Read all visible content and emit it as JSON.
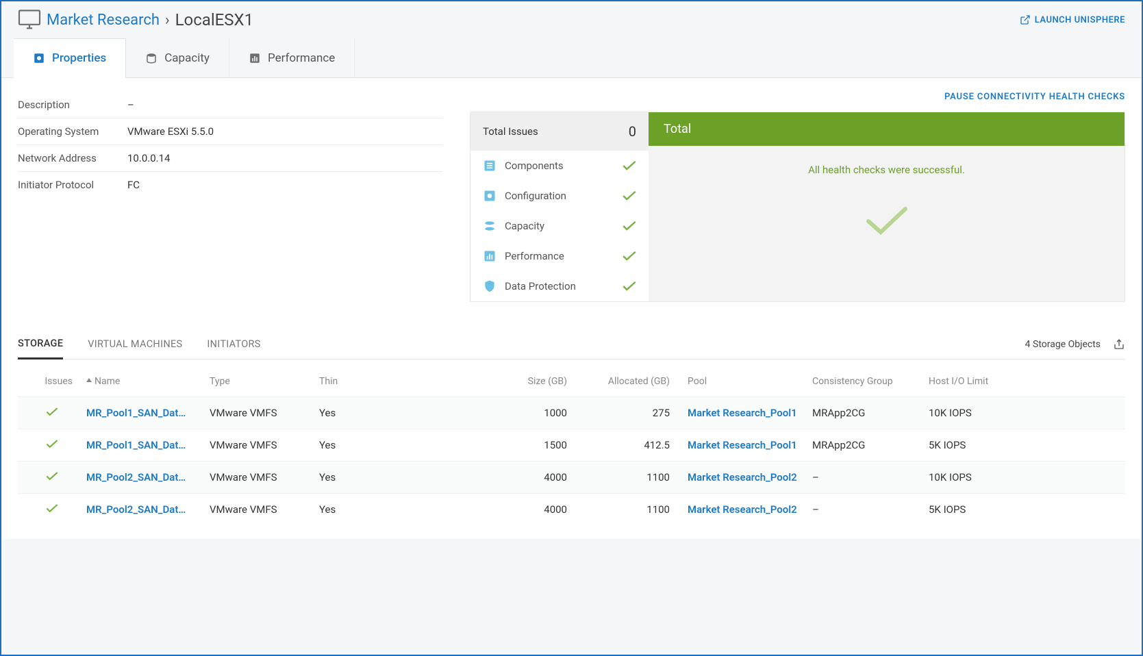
{
  "breadcrumb": {
    "parent": "Market Research",
    "current": "LocalESX1"
  },
  "launch_unisphere": "LAUNCH UNISPHERE",
  "tabs": {
    "properties": "Properties",
    "capacity": "Capacity",
    "performance": "Performance"
  },
  "properties": {
    "description_label": "Description",
    "description_value": "–",
    "os_label": "Operating System",
    "os_value": "VMware ESXi 5.5.0",
    "net_label": "Network Address",
    "net_value": "10.0.0.14",
    "init_label": "Initiator Protocol",
    "init_value": "FC"
  },
  "pause_link": "PAUSE CONNECTIVITY HEALTH CHECKS",
  "health": {
    "total_label": "Total Issues",
    "total_count": "0",
    "right_header": "Total",
    "message": "All health checks were successful.",
    "items": {
      "components": "Components",
      "configuration": "Configuration",
      "capacity": "Capacity",
      "performance": "Performance",
      "data_protection": "Data Protection"
    }
  },
  "sub_tabs": {
    "storage": "STORAGE",
    "vms": "VIRTUAL MACHINES",
    "initiators": "INITIATORS",
    "count": "4 Storage Objects"
  },
  "columns": {
    "issues": "Issues",
    "name": "Name",
    "type": "Type",
    "thin": "Thin",
    "size": "Size (GB)",
    "allocated": "Allocated (GB)",
    "pool": "Pool",
    "cg": "Consistency Group",
    "host_io": "Host I/O Limit"
  },
  "rows": [
    {
      "name": "MR_Pool1_SAN_Dat…",
      "type": "VMware VMFS",
      "thin": "Yes",
      "size": "1000",
      "alloc": "275",
      "pool": "Market Research_Pool1",
      "cg": "MRApp2CG",
      "hio": "10K IOPS"
    },
    {
      "name": "MR_Pool1_SAN_Dat…",
      "type": "VMware VMFS",
      "thin": "Yes",
      "size": "1500",
      "alloc": "412.5",
      "pool": "Market Research_Pool1",
      "cg": "MRApp2CG",
      "hio": "5K IOPS"
    },
    {
      "name": "MR_Pool2_SAN_Dat…",
      "type": "VMware VMFS",
      "thin": "Yes",
      "size": "4000",
      "alloc": "1100",
      "pool": "Market Research_Pool2",
      "cg": "–",
      "hio": "10K IOPS"
    },
    {
      "name": "MR_Pool2_SAN_Dat…",
      "type": "VMware VMFS",
      "thin": "Yes",
      "size": "4000",
      "alloc": "1100",
      "pool": "Market Research_Pool2",
      "cg": "–",
      "hio": "5K IOPS"
    }
  ]
}
